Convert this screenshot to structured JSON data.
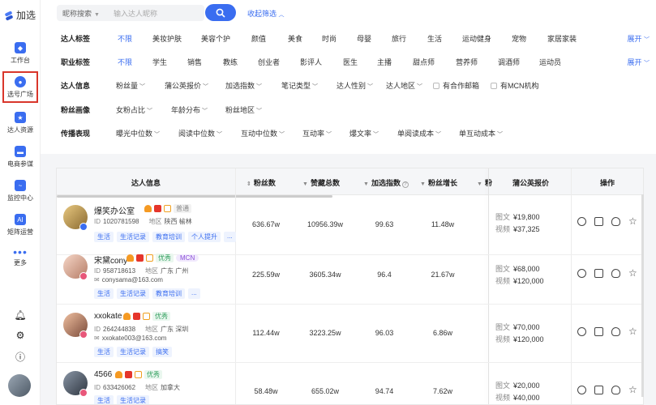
{
  "app": {
    "name": "加选"
  },
  "sidebar": {
    "items": [
      {
        "label": "工作台",
        "icon": "layers-icon"
      },
      {
        "label": "选号广场",
        "icon": "person-icon",
        "active": true
      },
      {
        "label": "达人资源",
        "icon": "star-folder-icon"
      },
      {
        "label": "电商参谋",
        "icon": "shop-icon"
      },
      {
        "label": "监控中心",
        "icon": "monitor-icon"
      },
      {
        "label": "矩阵运营",
        "icon": "ai-icon"
      },
      {
        "label": "更多",
        "icon": "more-icon"
      }
    ],
    "bottom_icons": [
      "bell-icon",
      "plugin-icon",
      "help-icon"
    ]
  },
  "search": {
    "type": "昵称搜索",
    "placeholder": "输入达人昵称",
    "collapse": "收起筛选"
  },
  "filters": {
    "talent_tags": {
      "label": "达人标签",
      "options": [
        "不限",
        "美妆护肤",
        "美容个护",
        "颜值",
        "美食",
        "时尚",
        "母婴",
        "旅行",
        "生活",
        "运动健身",
        "宠物",
        "家居家装"
      ],
      "expand": "展开"
    },
    "job_tags": {
      "label": "职业标签",
      "options": [
        "不限",
        "学生",
        "销售",
        "教练",
        "创业者",
        "影评人",
        "医生",
        "主播",
        "甜点师",
        "营养师",
        "调酒师",
        "运动员"
      ],
      "expand": "展开"
    },
    "talent_info": {
      "label": "达人信息",
      "dropdowns": [
        "粉丝量",
        "蒲公英报价",
        "加选指数",
        "笔记类型",
        "达人性别",
        "达人地区"
      ],
      "checks": [
        "有合作邮箱",
        "有MCN机构"
      ]
    },
    "fan_profile": {
      "label": "粉丝画像",
      "dropdowns": [
        "女粉占比",
        "年龄分布",
        "粉丝地区"
      ]
    },
    "spread": {
      "label": "传播表现",
      "dropdowns": [
        "曝光中位数",
        "阅读中位数",
        "互动中位数",
        "互动率",
        "爆文率",
        "单阅读成本",
        "单互动成本"
      ]
    }
  },
  "table": {
    "headers": {
      "info": "达人信息",
      "fans": "粉丝数",
      "likes": "赞藏总数",
      "index": "加选指数",
      "growth": "粉丝增长",
      "more": "粉",
      "price": "蒲公英报价",
      "ops": "操作"
    },
    "rows": [
      {
        "name": "爆笑办公室",
        "level": "普通",
        "level_type": "plain",
        "mcn": "",
        "id_label": "ID",
        "id": "1020781598",
        "region_label": "地区",
        "region": "陕西 榆林",
        "email": "",
        "tags": [
          "生活",
          "生活记录",
          "教育培训",
          "个人提升",
          "..."
        ],
        "fans": "636.67w",
        "likes": "10956.39w",
        "index": "99.63",
        "growth": "11.48w",
        "img_label": "图文",
        "img_price": "¥19,800",
        "video_label": "视频",
        "video_price": "¥37,325",
        "avatar_color": "#c8a050",
        "badge_color": "#3a6df0"
      },
      {
        "name": "宋黛cony",
        "level": "优秀",
        "level_type": "good",
        "mcn": "MCN",
        "id_label": "ID",
        "id": "958718613",
        "region_label": "地区",
        "region": "广东 广州",
        "email": "conysama@163.com",
        "tags": [
          "生活",
          "生活记录",
          "教育培训",
          "..."
        ],
        "fans": "225.59w",
        "likes": "3605.34w",
        "index": "96.4",
        "growth": "21.67w",
        "img_label": "图文",
        "img_price": "¥68,000",
        "video_label": "视频",
        "video_price": "¥120,000",
        "avatar_color": "#e9b6a6",
        "badge_color": "#e8577a"
      },
      {
        "name": "xxokate",
        "level": "优秀",
        "level_type": "good",
        "mcn": "",
        "id_label": "ID",
        "id": "264244838",
        "region_label": "地区",
        "region": "广东 深圳",
        "email": "xxokate003@163.com",
        "tags": [
          "生活",
          "生活记录",
          "搞笑"
        ],
        "fans": "112.44w",
        "likes": "3223.25w",
        "index": "96.03",
        "growth": "6.86w",
        "img_label": "图文",
        "img_price": "¥70,000",
        "video_label": "视频",
        "video_price": "¥120,000",
        "avatar_color": "#d49070",
        "badge_color": "#e8577a"
      },
      {
        "name": "4566",
        "level": "优秀",
        "level_type": "good",
        "mcn": "",
        "id_label": "ID",
        "id": "633426062",
        "region_label": "地区",
        "region": "加拿大",
        "email": "",
        "tags": [
          "生活",
          "生活记录"
        ],
        "fans": "58.48w",
        "likes": "655.02w",
        "index": "94.74",
        "growth": "7.62w",
        "img_label": "图文",
        "img_price": "¥20,000",
        "video_label": "视频",
        "video_price": "¥40,000",
        "avatar_color": "#556070",
        "badge_color": "#e8577a"
      }
    ]
  }
}
